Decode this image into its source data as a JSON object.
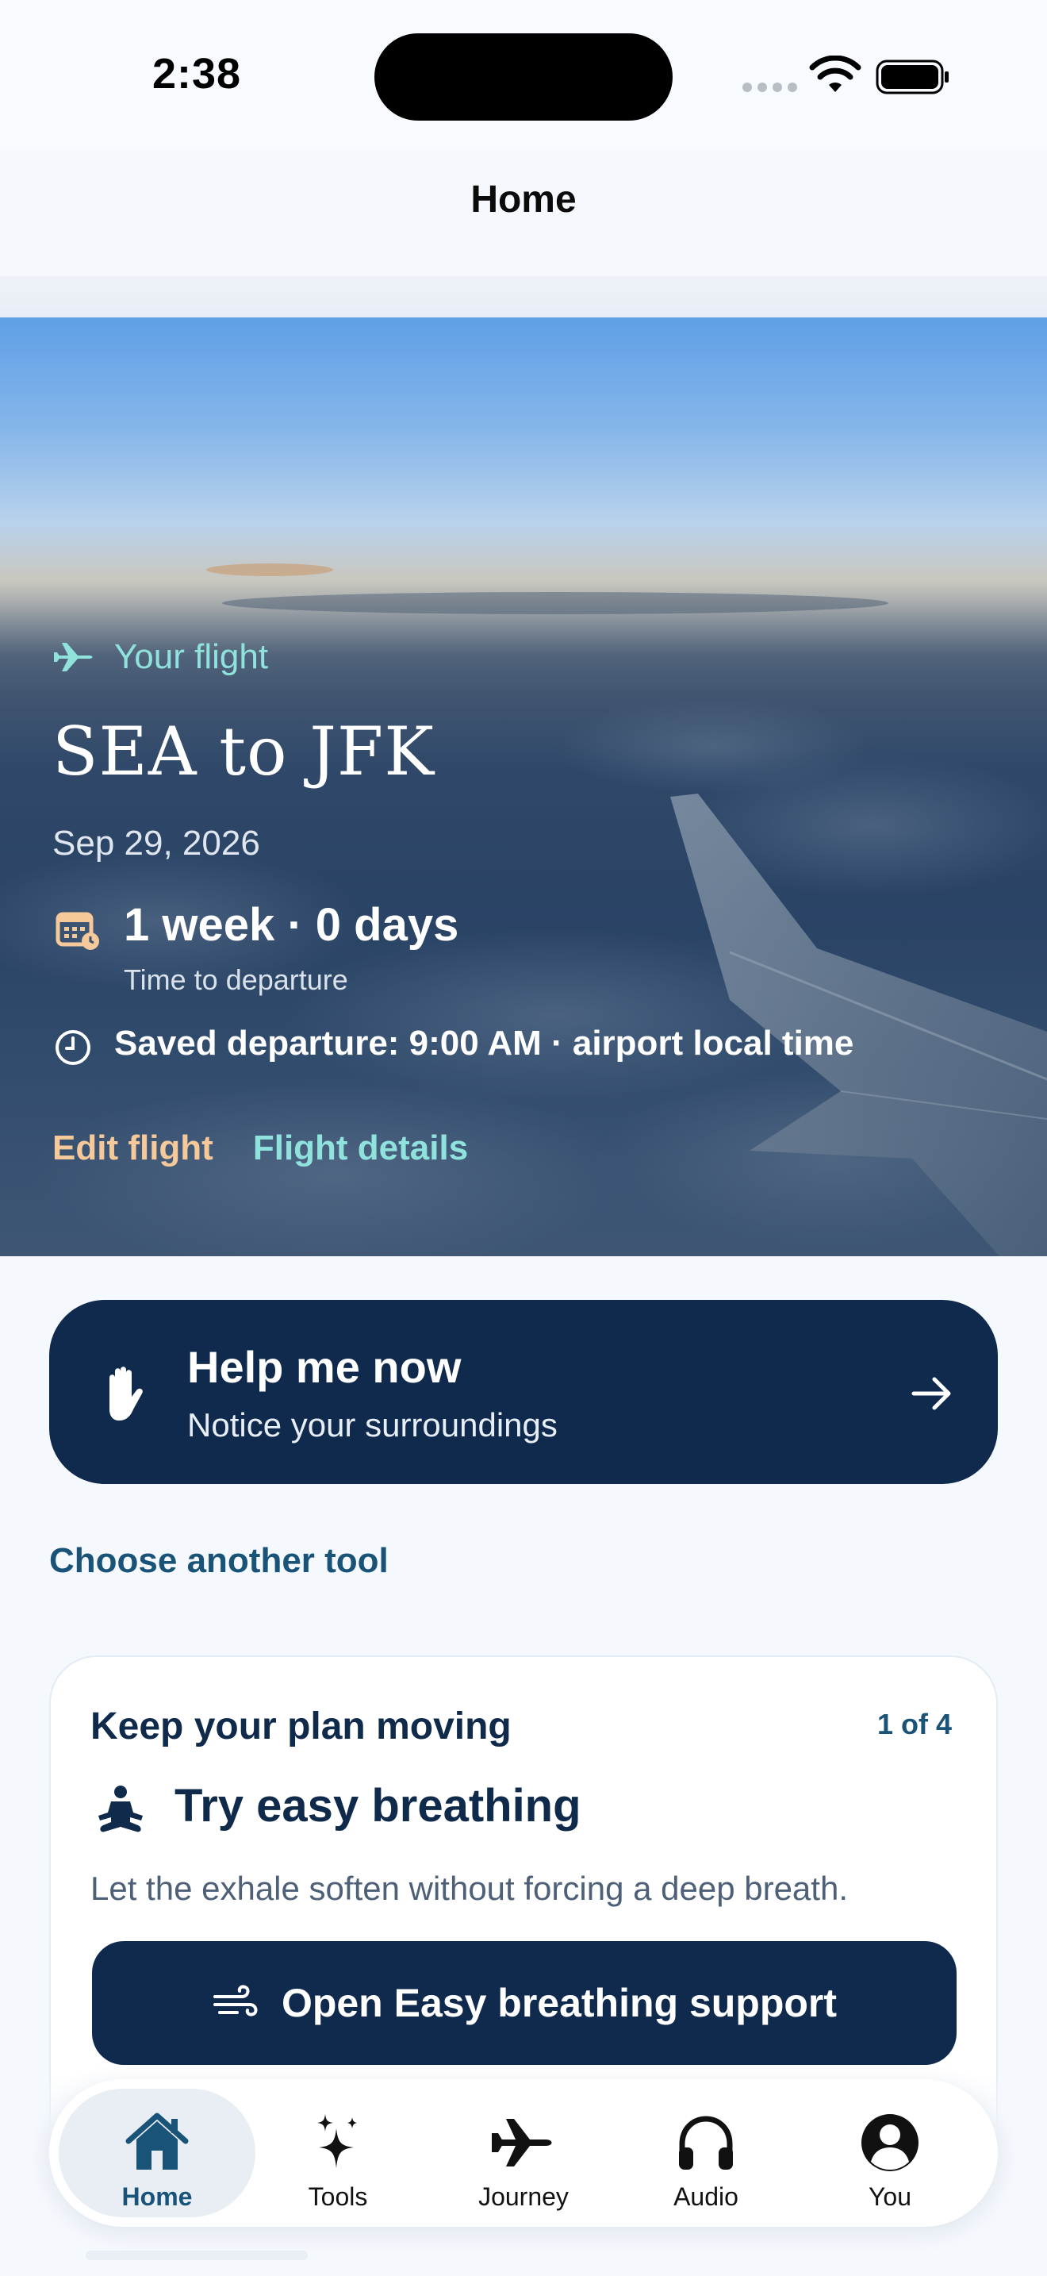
{
  "status_bar": {
    "time": "2:38"
  },
  "nav": {
    "title": "Home"
  },
  "flight": {
    "kicker": "Your flight",
    "route": "SEA to JFK",
    "date": "Sep 29, 2026",
    "countdown_value": "1 week · 0 days",
    "countdown_label": "Time to departure",
    "saved_departure": "Saved departure: 9:00 AM · airport local time",
    "edit_link": "Edit flight",
    "details_link": "Flight details"
  },
  "help": {
    "title": "Help me now",
    "subtitle": "Notice your surroundings"
  },
  "choose_tool": "Choose another tool",
  "plan": {
    "title": "Keep your plan moving",
    "count": "1 of 4",
    "step_title": "Try easy breathing",
    "step_description": "Let the exhale soften without forcing a deep breath.",
    "button_label": "Open Easy breathing support"
  },
  "tabs": [
    {
      "label": "Home",
      "icon": "house-icon",
      "active": true
    },
    {
      "label": "Tools",
      "icon": "sparkles-icon",
      "active": false
    },
    {
      "label": "Journey",
      "icon": "airplane-icon",
      "active": false
    },
    {
      "label": "Audio",
      "icon": "headphones-icon",
      "active": false
    },
    {
      "label": "You",
      "icon": "person-circle-icon",
      "active": false
    }
  ],
  "colors": {
    "navy": "#0f2a4d",
    "teal_accent": "#8fe3dc",
    "peach_accent": "#f5c99a",
    "link_blue": "#1a5378",
    "background": "#f5f8fd"
  }
}
